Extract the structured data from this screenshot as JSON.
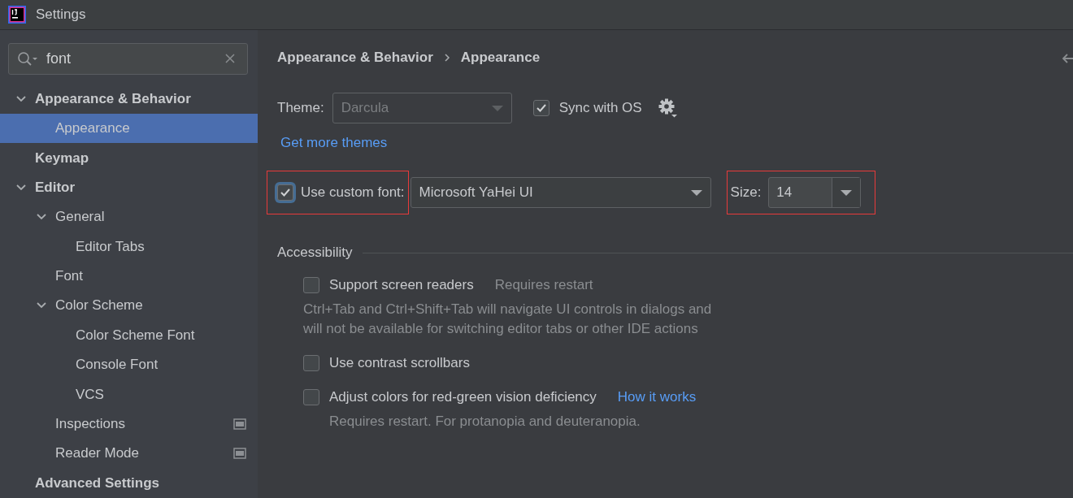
{
  "window": {
    "title": "Settings"
  },
  "search": {
    "value": "font"
  },
  "sidebar": {
    "items": [
      {
        "label": "Appearance & Behavior",
        "expanded": true,
        "selected": false,
        "badge": false,
        "children": [
          {
            "label": "Appearance",
            "selected": true,
            "badge": false
          }
        ]
      },
      {
        "label": "Keymap",
        "selected": false,
        "badge": false
      },
      {
        "label": "Editor",
        "expanded": true,
        "selected": false,
        "badge": false,
        "children": [
          {
            "label": "General",
            "expanded": true,
            "selected": false,
            "badge": false,
            "children": [
              {
                "label": "Editor Tabs",
                "selected": false,
                "badge": false
              }
            ]
          },
          {
            "label": "Font",
            "selected": false,
            "badge": false
          },
          {
            "label": "Color Scheme",
            "expanded": true,
            "selected": false,
            "badge": false,
            "children": [
              {
                "label": "Color Scheme Font",
                "selected": false,
                "badge": false
              },
              {
                "label": "Console Font",
                "selected": false,
                "badge": false
              },
              {
                "label": "VCS",
                "selected": false,
                "badge": false
              }
            ]
          },
          {
            "label": "Inspections",
            "selected": false,
            "badge": true
          },
          {
            "label": "Reader Mode",
            "selected": false,
            "badge": true
          }
        ]
      },
      {
        "label": "Advanced Settings",
        "selected": false,
        "badge": false
      }
    ]
  },
  "breadcrumb": [
    "Appearance & Behavior",
    "Appearance"
  ],
  "theme": {
    "label": "Theme:",
    "value": "Darcula",
    "disabled": true,
    "sync": {
      "label": "Sync with OS",
      "checked": true
    }
  },
  "more_themes_link": "Get more themes",
  "font": {
    "checkbox": {
      "label": "Use custom font:",
      "checked": true,
      "highlighted": true
    },
    "value": "Microsoft YaHei UI",
    "size": {
      "label": "Size:",
      "value": "14",
      "highlighted": true
    }
  },
  "accessibility": {
    "title": "Accessibility",
    "options": [
      {
        "label": "Support screen readers",
        "checked": false,
        "note": "Requires restart",
        "description": "Ctrl+Tab and Ctrl+Shift+Tab will navigate UI controls in dialogs and will not be available for switching editor tabs or other IDE actions"
      },
      {
        "label": "Use contrast scrollbars",
        "checked": false
      },
      {
        "label": "Adjust colors for red-green vision deficiency",
        "checked": false,
        "link": "How it works",
        "description": "Requires restart. For protanopia and deuteranopia."
      }
    ]
  }
}
